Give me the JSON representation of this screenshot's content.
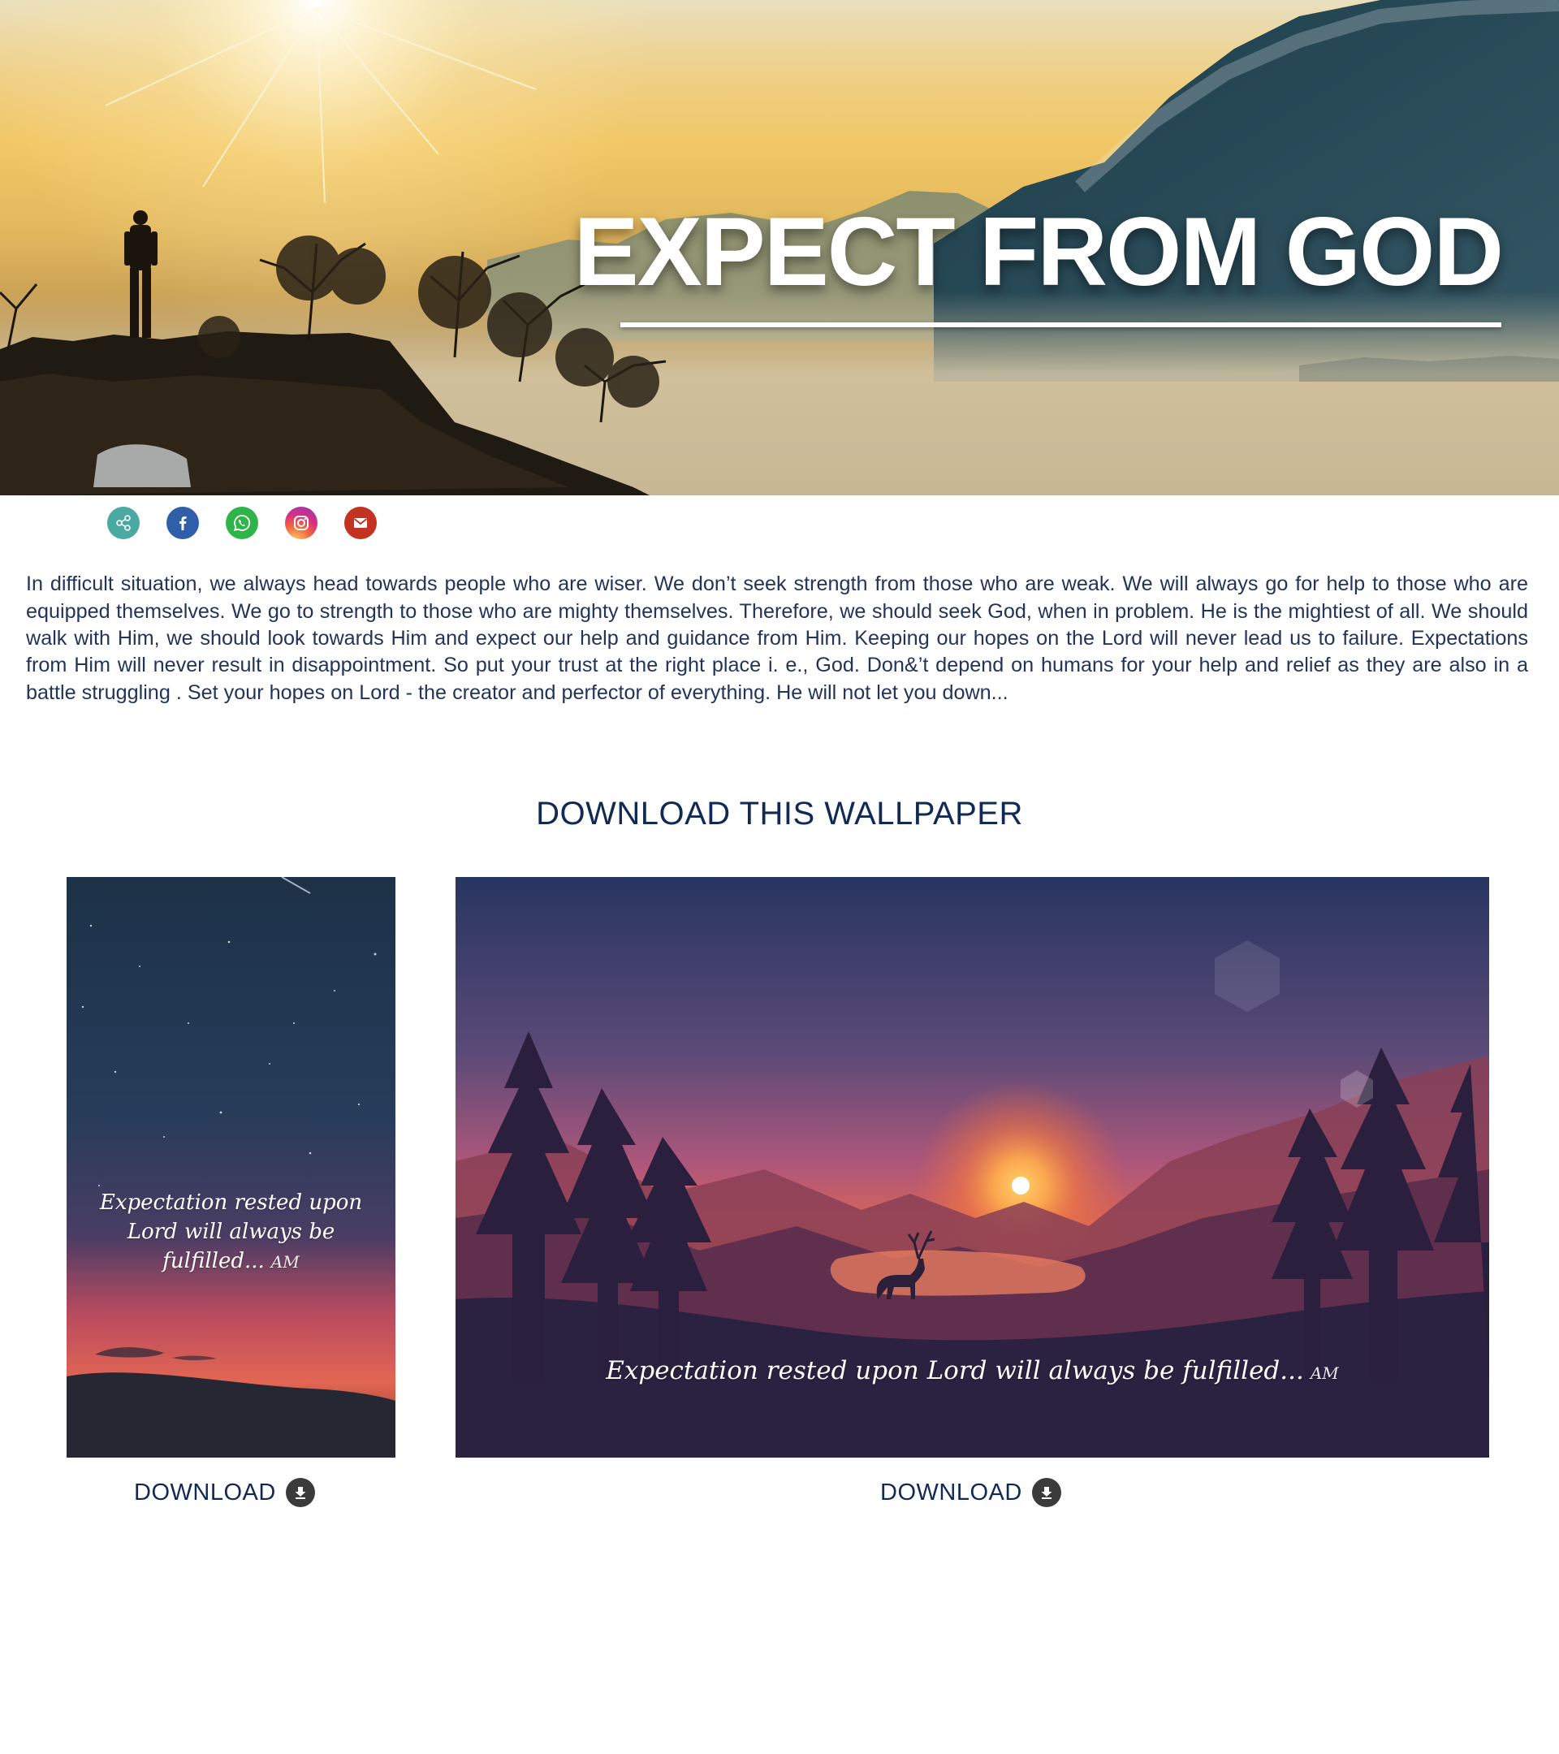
{
  "hero": {
    "title": "EXPECT FROM GOD"
  },
  "share": {
    "items": [
      {
        "icon": "share-icon",
        "color": "#4aa9a1"
      },
      {
        "icon": "facebook-icon",
        "color": "#2f5fa8"
      },
      {
        "icon": "whatsapp-icon",
        "color": "#2fb44a"
      },
      {
        "icon": "instagram-icon",
        "color": "#e4405f"
      },
      {
        "icon": "gmail-icon",
        "color": "#c23321"
      }
    ]
  },
  "article": {
    "body": "In difficult situation, we always head towards people who are wiser. We don’t seek strength from those who are weak. We will always go for help to those who are equipped themselves. We go to strength to those who are mighty themselves. Therefore, we should seek God, when in problem. He is the mightiest of all. We should walk with Him, we should look towards Him and expect our help and guidance from Him. Keeping our hopes on the Lord will never lead us to failure. Expectations from Him will never result in disappointment. So put your trust at the right place i. e., God. Don&’t depend on humans for your help and relief as they are also in a battle struggling . Set your hopes on Lord - the creator and perfector of everything. He will not let you down..."
  },
  "download_section": {
    "heading": "DOWNLOAD THIS WALLPAPER",
    "mobile": {
      "quote_line1": "Expectation rested upon",
      "quote_line2": "Lord will always be fulfilled...",
      "signature": "AM",
      "link_label": "DOWNLOAD"
    },
    "desktop": {
      "quote": "Expectation rested upon Lord will always be fulfilled...",
      "signature": "AM",
      "link_label": "DOWNLOAD"
    }
  },
  "colors": {
    "heading_text": "#112a55",
    "body_text": "#22345a",
    "download_icon_bg": "#3b3b3b"
  }
}
